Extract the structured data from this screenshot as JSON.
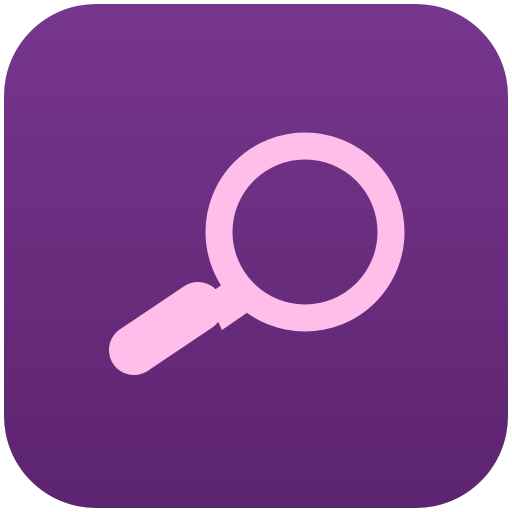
{
  "app_icon": {
    "icon": "search-icon",
    "background_top": "#77368d",
    "background_bottom": "#5c246f",
    "glyph_color": "#ffbde9"
  }
}
